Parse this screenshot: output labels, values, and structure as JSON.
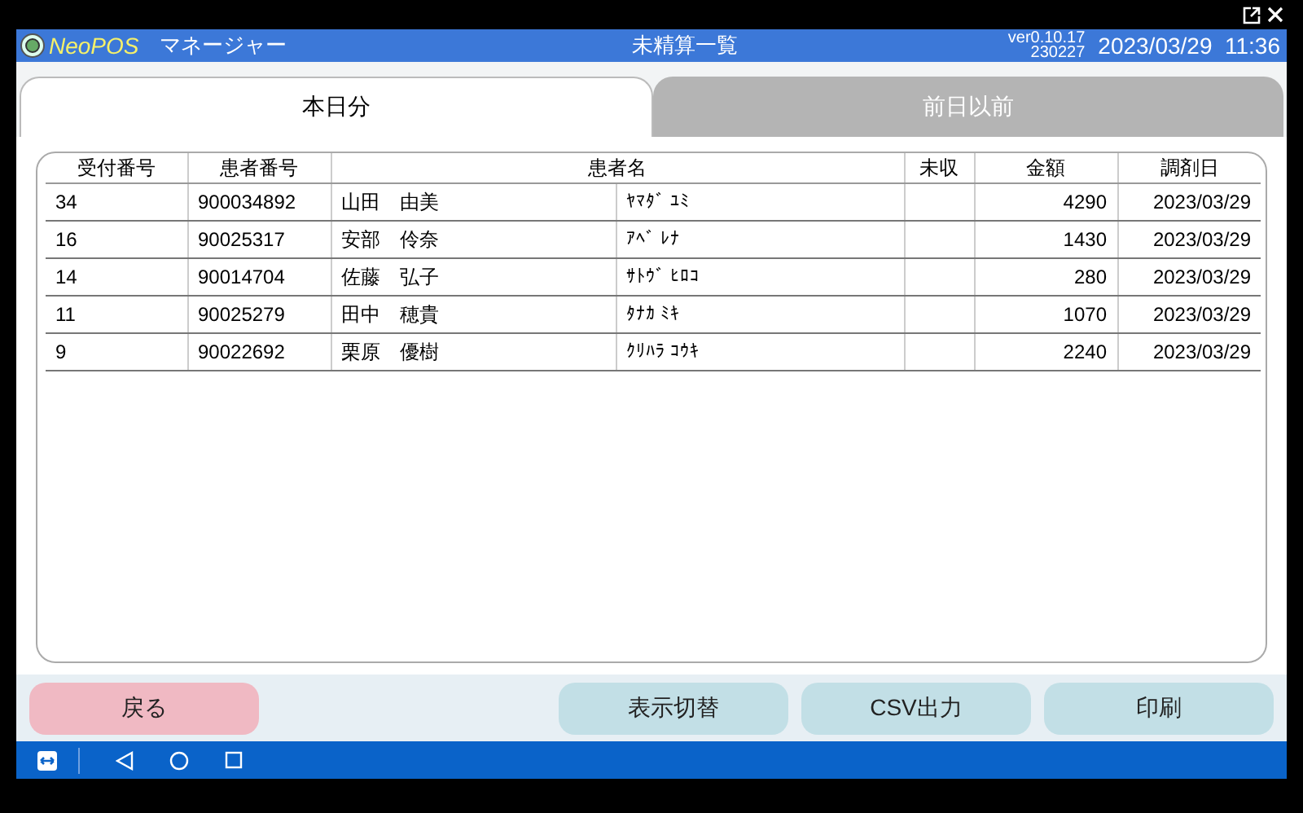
{
  "header": {
    "logo": "NeoPOS",
    "app": "マネージャー",
    "title": "未精算一覧",
    "version": "ver0.10.17",
    "build": "230227",
    "datetime": "2023/03/29  11:36"
  },
  "tabs": [
    {
      "label": "本日分",
      "selected": true
    },
    {
      "label": "前日以前",
      "selected": false
    }
  ],
  "table": {
    "columns": [
      "受付番号",
      "患者番号",
      "患者名",
      "未収",
      "金額",
      "調剤日"
    ],
    "rows": [
      {
        "reception": "34",
        "patient_no": "900034892",
        "name": "山田　由美",
        "kana": "ﾔﾏﾀﾞ ﾕﾐ",
        "unpaid": "",
        "amount": "4290",
        "date": "2023/03/29"
      },
      {
        "reception": "16",
        "patient_no": "90025317",
        "name": "安部　伶奈",
        "kana": "ｱﾍﾞ ﾚﾅ",
        "unpaid": "",
        "amount": "1430",
        "date": "2023/03/29"
      },
      {
        "reception": "14",
        "patient_no": "90014704",
        "name": "佐藤　弘子",
        "kana": "ｻﾄｳﾞ ﾋﾛｺ",
        "unpaid": "",
        "amount": "280",
        "date": "2023/03/29"
      },
      {
        "reception": "11",
        "patient_no": "90025279",
        "name": "田中　穂貴",
        "kana": "ﾀﾅｶ ﾐｷ",
        "unpaid": "",
        "amount": "1070",
        "date": "2023/03/29"
      },
      {
        "reception": "9",
        "patient_no": "90022692",
        "name": "栗原　優樹",
        "kana": "ｸﾘﾊﾗ ｺｳｷ",
        "unpaid": "",
        "amount": "2240",
        "date": "2023/03/29"
      }
    ]
  },
  "buttons": [
    {
      "label": "戻る",
      "kind": "back"
    },
    {
      "label": "表示切替",
      "kind": "action"
    },
    {
      "label": "CSV出力",
      "kind": "action"
    },
    {
      "label": "印刷",
      "kind": "action"
    }
  ]
}
